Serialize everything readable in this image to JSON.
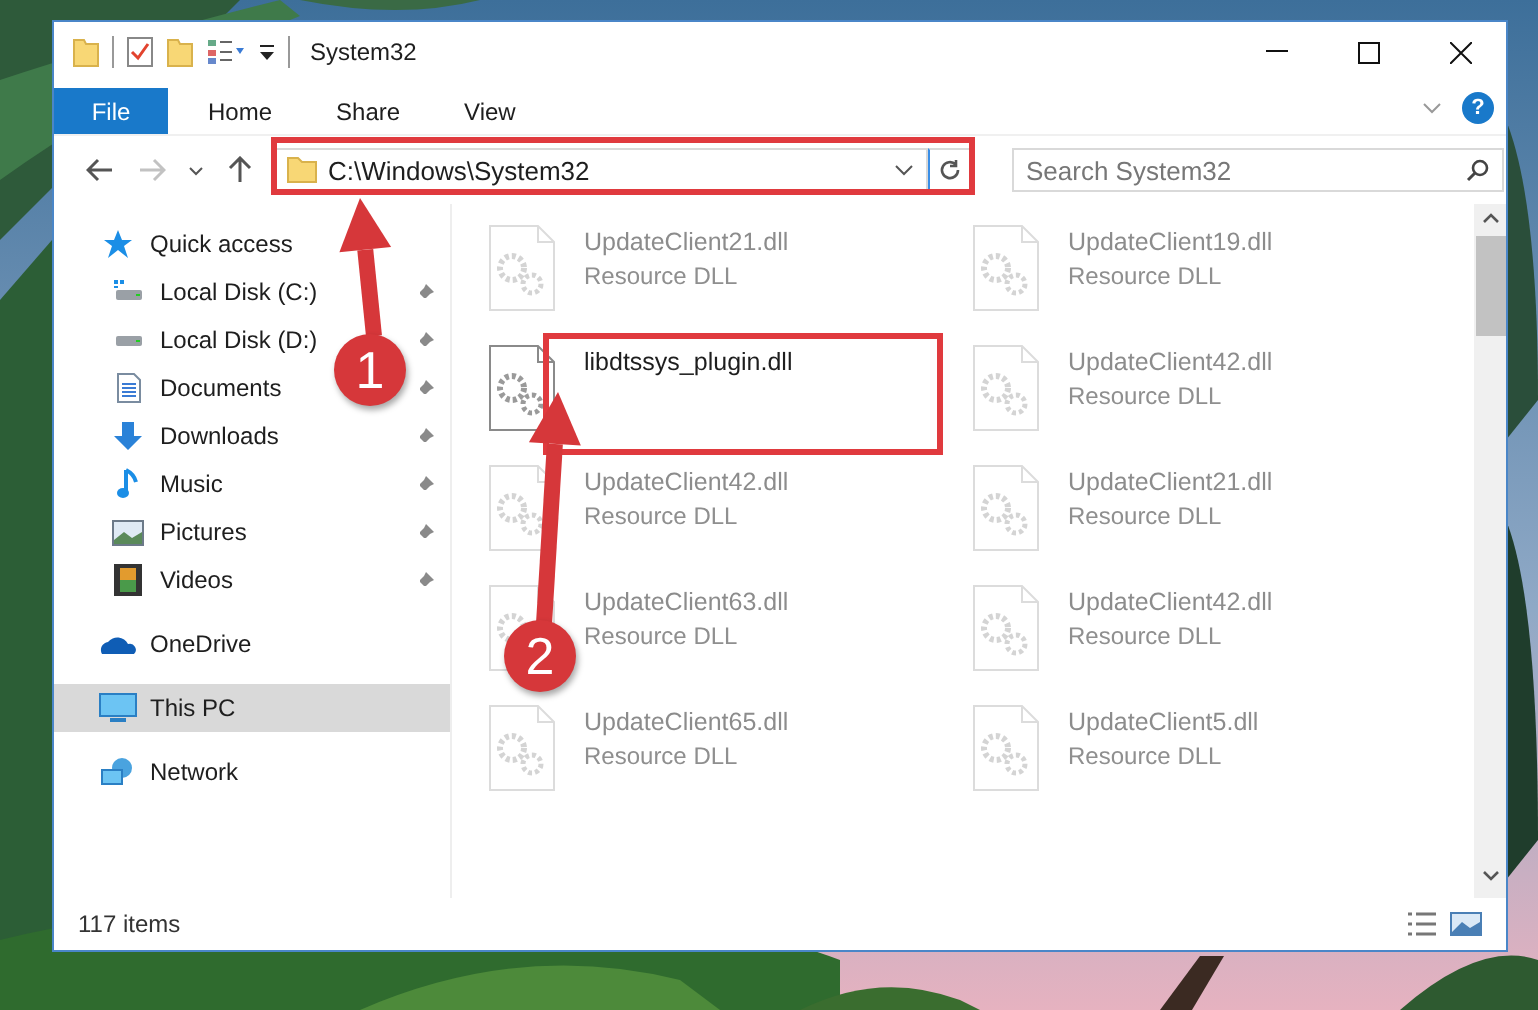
{
  "window": {
    "title": "System32"
  },
  "ribbon": {
    "file_tab": "File",
    "tabs": [
      "Home",
      "Share",
      "View"
    ],
    "help": "?"
  },
  "navigation": {
    "back": {
      "disabled": false
    },
    "forward": {
      "disabled": true
    },
    "up": {
      "disabled": false
    }
  },
  "address": {
    "path": "C:\\Windows\\System32"
  },
  "search": {
    "placeholder": "Search System32"
  },
  "sidebar": {
    "items": [
      {
        "label": "Quick access",
        "selected": false,
        "children": [
          {
            "label": "Local Disk (C:)",
            "pinned": true,
            "selected": false
          },
          {
            "label": "Local Disk (D:)",
            "pinned": true,
            "selected": false
          },
          {
            "label": "Documents",
            "pinned": true,
            "selected": false
          },
          {
            "label": "Downloads",
            "pinned": true,
            "selected": false
          },
          {
            "label": "Music",
            "pinned": true,
            "selected": false
          },
          {
            "label": "Pictures",
            "pinned": true,
            "selected": false
          },
          {
            "label": "Videos",
            "pinned": true,
            "selected": false
          }
        ]
      },
      {
        "label": "OneDrive",
        "selected": false
      },
      {
        "label": "This PC",
        "selected": true
      },
      {
        "label": "Network",
        "selected": false
      }
    ]
  },
  "files": [
    {
      "name": "UpdateClient21.dll",
      "type": "Resource DLL",
      "dimmed": true
    },
    {
      "name": "UpdateClient19.dll",
      "type": "Resource DLL",
      "dimmed": true
    },
    {
      "name": "libdtssys_plugin.dll",
      "dimmed": false
    },
    {
      "name": "UpdateClient42.dll",
      "type": "Resource DLL",
      "dimmed": true
    },
    {
      "name": "UpdateClient42.dll",
      "type": "Resource DLL",
      "dimmed": true
    },
    {
      "name": "UpdateClient21.dll",
      "type": "Resource DLL",
      "dimmed": true
    },
    {
      "name": "UpdateClient63.dll",
      "type": "Resource DLL",
      "dimmed": true
    },
    {
      "name": "UpdateClient42.dll",
      "type": "Resource DLL",
      "dimmed": true
    },
    {
      "name": "UpdateClient65.dll",
      "type": "Resource DLL",
      "dimmed": true
    },
    {
      "name": "UpdateClient5.dll",
      "type": "Resource DLL",
      "dimmed": true
    }
  ],
  "status_bar": {
    "count": "117 items"
  },
  "annotations": [
    {
      "number": "1"
    },
    {
      "number": "2"
    }
  ]
}
